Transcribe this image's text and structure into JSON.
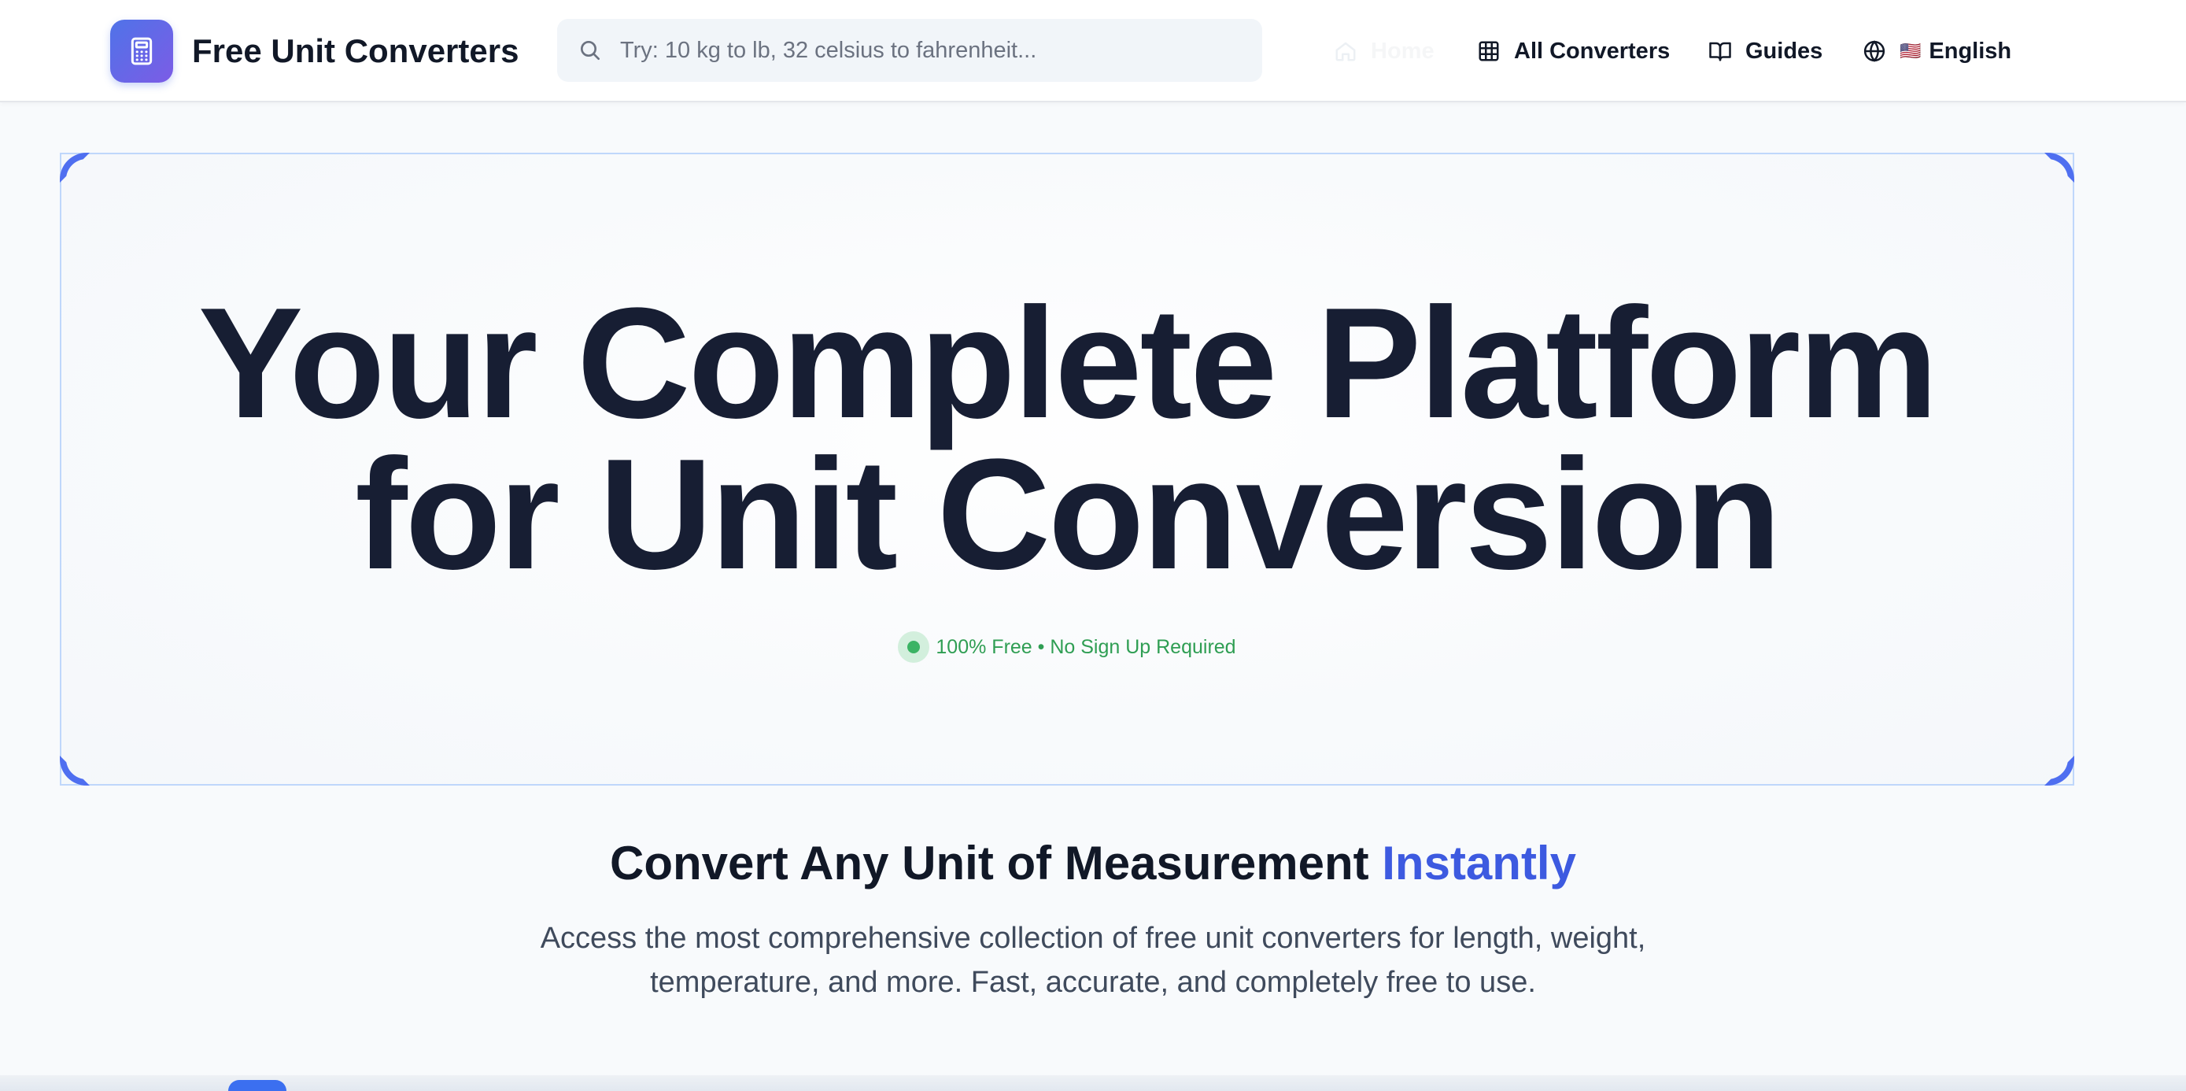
{
  "header": {
    "brand": "Free Unit Converters",
    "search_placeholder": "Try: 10 kg to lb, 32 celsius to fahrenheit...",
    "nav": {
      "home": "Home",
      "all_converters": "All Converters",
      "guides": "Guides",
      "language_flag": "🇺🇸",
      "language": "English"
    }
  },
  "hero": {
    "title_line1": "Your Complete Platform",
    "title_line2": "for Unit Conversion",
    "badge": "100% Free • No Sign Up Required"
  },
  "intro": {
    "heading_main": "Convert Any Unit of Measurement ",
    "heading_accent": "Instantly",
    "description": "Access the most comprehensive collection of free unit converters for length, weight, temperature, and more. Fast, accurate, and completely free to use."
  },
  "colors": {
    "accent": "#3d5ae0",
    "logo_gradient_start": "#4f73e8",
    "logo_gradient_end": "#7c5ce6",
    "badge_green": "#2f9e53",
    "hero_border": "#bfd7fb"
  },
  "icons": {
    "logo": "calculator-icon",
    "search": "search-icon",
    "home": "home-icon",
    "all_converters": "grid-icon",
    "guides": "book-open-icon",
    "language": "globe-icon"
  }
}
